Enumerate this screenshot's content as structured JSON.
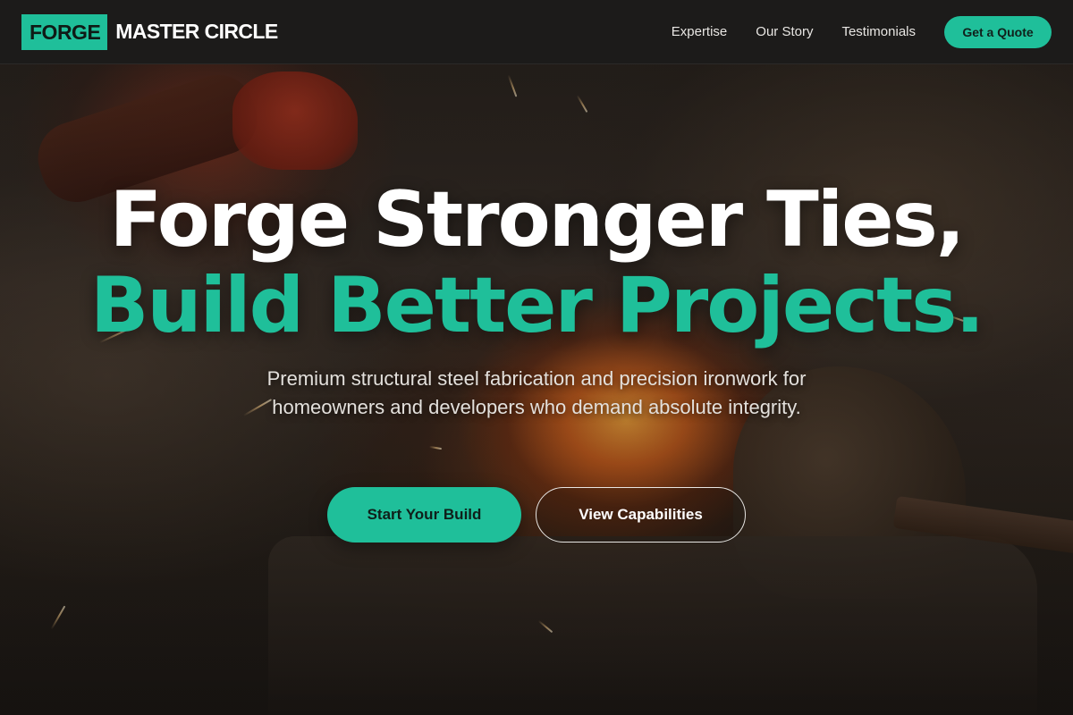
{
  "brand": {
    "box_text": "FORGE",
    "name": "MASTER CIRCLE"
  },
  "nav": {
    "links": [
      "Expertise",
      "Our Story",
      "Testimonials"
    ],
    "cta_label": "Get a Quote"
  },
  "hero": {
    "title_line_1": "Forge Stronger Ties,",
    "title_line_2": "Build Better Projects.",
    "subtitle": "Premium structural steel fabrication and precision ironwork for homeowners and developers who demand absolute integrity.",
    "primary_button": "Start Your Build",
    "secondary_button": "View Capabilities"
  },
  "colors": {
    "accent": "#1fbf9a",
    "nav_background": "#1c1b1a",
    "title_text": "#ffffff"
  }
}
